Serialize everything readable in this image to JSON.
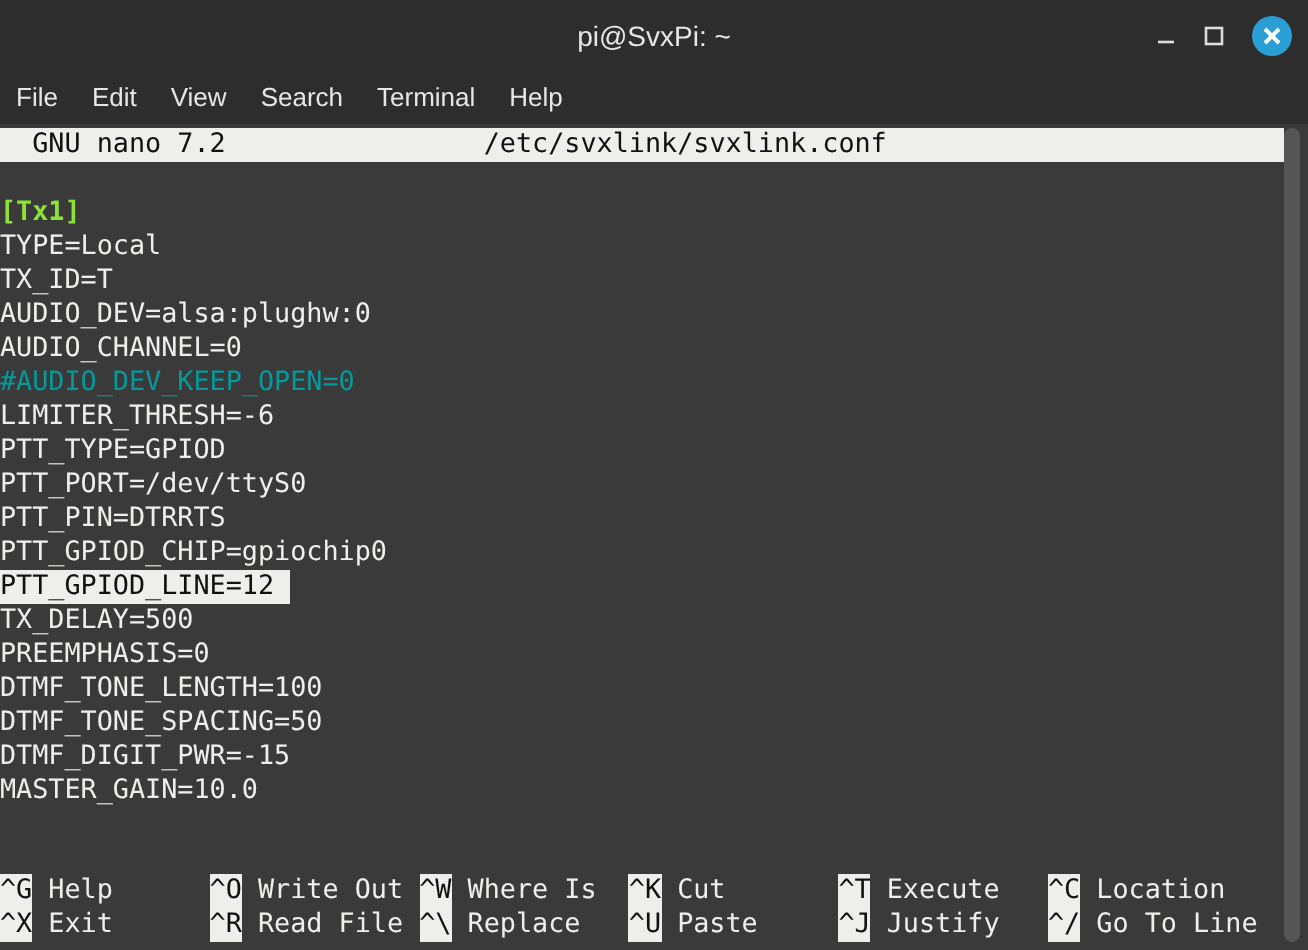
{
  "window": {
    "title": "pi@SvxPi: ~"
  },
  "menu": [
    "File",
    "Edit",
    "View",
    "Search",
    "Terminal",
    "Help"
  ],
  "nano_header": {
    "version": "GNU nano 7.2",
    "file": "/etc/svxlink/svxlink.conf"
  },
  "lines": [
    {
      "kind": "section",
      "text": "[Tx1]",
      "selected": false
    },
    {
      "kind": "setting",
      "text": "TYPE=Local",
      "selected": false
    },
    {
      "kind": "setting",
      "text": "TX_ID=T",
      "selected": false
    },
    {
      "kind": "setting",
      "text": "AUDIO_DEV=alsa:plughw:0",
      "selected": false
    },
    {
      "kind": "setting",
      "text": "AUDIO_CHANNEL=0",
      "selected": false
    },
    {
      "kind": "comment",
      "text": "#AUDIO_DEV_KEEP_OPEN=0",
      "selected": false
    },
    {
      "kind": "setting",
      "text": "LIMITER_THRESH=-6",
      "selected": false
    },
    {
      "kind": "setting",
      "text": "PTT_TYPE=GPIOD",
      "selected": false
    },
    {
      "kind": "setting",
      "text": "PTT_PORT=/dev/ttyS0",
      "selected": false
    },
    {
      "kind": "setting",
      "text": "PTT_PIN=DTRRTS",
      "selected": false
    },
    {
      "kind": "setting",
      "text": "PTT_GPIOD_CHIP=gpiochip0",
      "selected": false
    },
    {
      "kind": "setting",
      "text": "PTT_GPIOD_LINE=12",
      "selected": true
    },
    {
      "kind": "setting",
      "text": "TX_DELAY=500",
      "selected": false
    },
    {
      "kind": "setting",
      "text": "PREEMPHASIS=0",
      "selected": false
    },
    {
      "kind": "setting",
      "text": "DTMF_TONE_LENGTH=100",
      "selected": false
    },
    {
      "kind": "setting",
      "text": "DTMF_TONE_SPACING=50",
      "selected": false
    },
    {
      "kind": "setting",
      "text": "DTMF_DIGIT_PWR=-15",
      "selected": false
    },
    {
      "kind": "setting",
      "text": "MASTER_GAIN=10.0",
      "selected": false
    }
  ],
  "shortcuts": [
    {
      "key": "^G",
      "label": "Help"
    },
    {
      "key": "^O",
      "label": "Write Out"
    },
    {
      "key": "^W",
      "label": "Where Is"
    },
    {
      "key": "^K",
      "label": "Cut"
    },
    {
      "key": "^T",
      "label": "Execute"
    },
    {
      "key": "^C",
      "label": "Location"
    },
    {
      "key": "^X",
      "label": "Exit"
    },
    {
      "key": "^R",
      "label": "Read File"
    },
    {
      "key": "^\\",
      "label": "Replace"
    },
    {
      "key": "^U",
      "label": "Paste"
    },
    {
      "key": "^J",
      "label": "Justify"
    },
    {
      "key": "^/",
      "label": "Go To Line"
    }
  ]
}
